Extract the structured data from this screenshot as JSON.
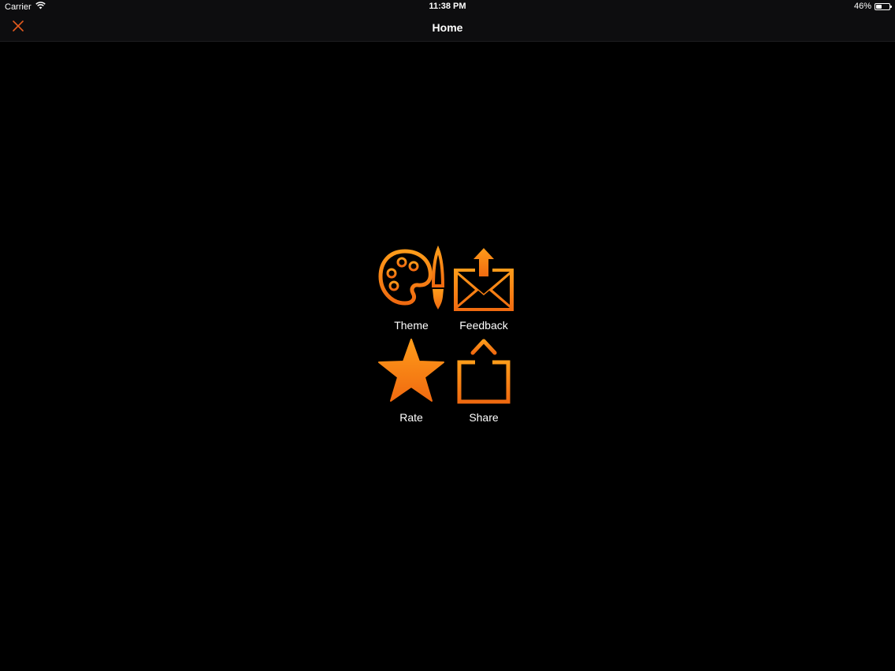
{
  "status_bar": {
    "carrier": "Carrier",
    "time": "11:38 PM",
    "battery_text": "46%",
    "battery_level": 0.46,
    "icons": [
      "wifi-icon",
      "battery-icon"
    ]
  },
  "nav_bar": {
    "title": "Home",
    "close_icon": "close-icon"
  },
  "menu": {
    "items": [
      {
        "label": "Theme",
        "icon": "palette-brush-icon"
      },
      {
        "label": "Feedback",
        "icon": "mail-upload-icon"
      },
      {
        "label": "Rate",
        "icon": "star-icon"
      },
      {
        "label": "Share",
        "icon": "share-icon"
      }
    ]
  },
  "colors": {
    "background": "#000000",
    "bar_background": "#0d0d0f",
    "accent_light": "#ff9c1a",
    "accent_dark": "#f06a10",
    "close_icon": "#e35a1f",
    "text": "#ffffff"
  }
}
